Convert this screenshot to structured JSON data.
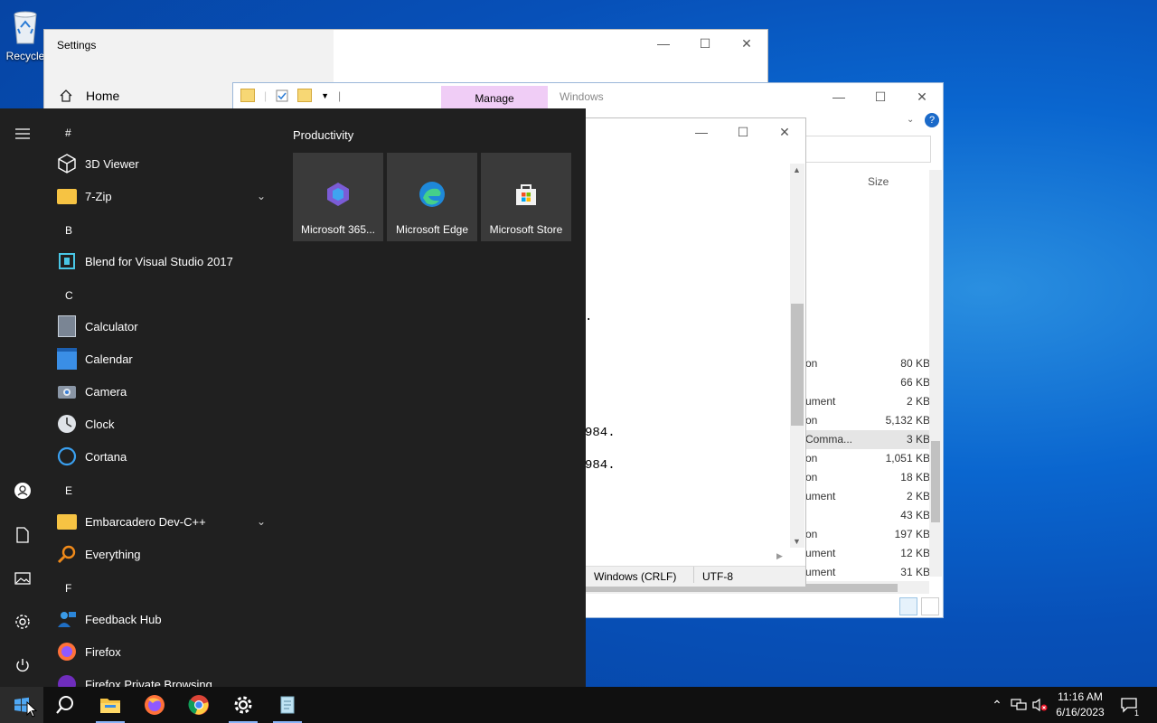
{
  "desktop": {
    "recycle_bin_label": "Recycle"
  },
  "settings_window": {
    "title": "Settings",
    "home_label": "Home"
  },
  "explorer_window": {
    "manage_tab": "Manage",
    "title": "Windows",
    "size_header": "Size",
    "rows": [
      {
        "type": "on",
        "size": "80 KB"
      },
      {
        "type": "",
        "size": "66 KB"
      },
      {
        "type": "ument",
        "size": "2 KB"
      },
      {
        "type": "on",
        "size": "5,132 KB"
      },
      {
        "type": "Comma...",
        "size": "3 KB"
      },
      {
        "type": "on",
        "size": "1,051 KB"
      },
      {
        "type": "on",
        "size": "18 KB"
      },
      {
        "type": "ument",
        "size": "2 KB"
      },
      {
        "type": "",
        "size": "43 KB"
      },
      {
        "type": "on",
        "size": "197 KB"
      },
      {
        "type": "ument",
        "size": "12 KB"
      },
      {
        "type": "ument",
        "size": "31 KB"
      }
    ]
  },
  "notepad_window": {
    "lines": [
      ".",
      "984.",
      "984."
    ],
    "line_ending": "Windows (CRLF)",
    "encoding": "UTF-8"
  },
  "start_menu": {
    "letters": [
      "#",
      "B",
      "C",
      "E",
      "F"
    ],
    "apps": [
      {
        "label": "3D Viewer"
      },
      {
        "label": "7-Zip"
      },
      {
        "label": "Blend for Visual Studio 2017"
      },
      {
        "label": "Calculator"
      },
      {
        "label": "Calendar"
      },
      {
        "label": "Camera"
      },
      {
        "label": "Clock"
      },
      {
        "label": "Cortana"
      },
      {
        "label": "Embarcadero Dev-C++"
      },
      {
        "label": "Everything"
      },
      {
        "label": "Feedback Hub"
      },
      {
        "label": "Firefox"
      },
      {
        "label": "Firefox Private Browsing"
      }
    ],
    "tiles_group": "Productivity",
    "tiles": [
      {
        "label": "Microsoft 365..."
      },
      {
        "label": "Microsoft Edge"
      },
      {
        "label": "Microsoft Store"
      }
    ]
  },
  "taskbar": {
    "time": "11:16 AM",
    "date": "6/16/2023",
    "notification_count": "1"
  }
}
